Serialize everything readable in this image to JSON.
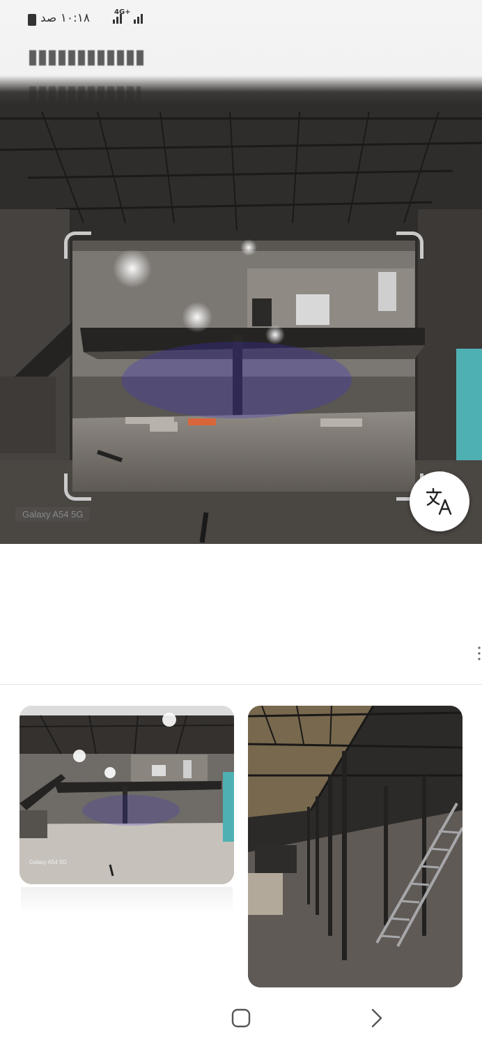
{
  "status_bar": {
    "time_text": "۱۰:۱۸ صد",
    "network_label": "4G+",
    "icons": [
      "battery-icon",
      "signal-icon",
      "signal-icon"
    ]
  },
  "hero": {
    "photo_watermark": "Galaxy A54 5G",
    "translate_button_icon": "translate-icon"
  },
  "results": {
    "cards": [
      {
        "watermark": "Galaxy A54 5G"
      },
      {
        "watermark": ""
      }
    ]
  },
  "nav": {
    "icons": [
      "home-square-icon",
      "forward-chevron-icon"
    ]
  },
  "colors": {
    "scan_corner": "#d2d2d2",
    "background": "#ffffff",
    "card_bg": "#e9e9e9"
  }
}
